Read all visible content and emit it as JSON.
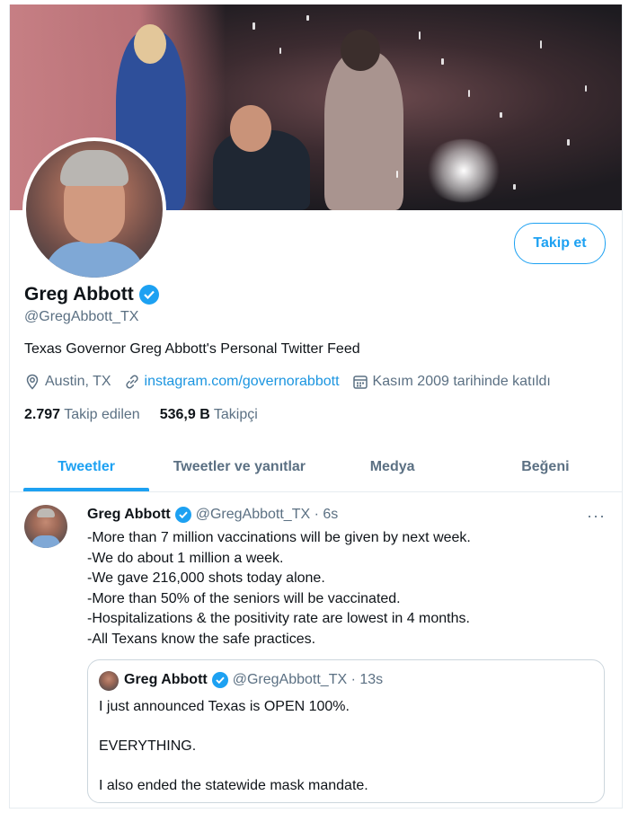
{
  "profile": {
    "name": "Greg Abbott",
    "handle": "@GregAbbott_TX",
    "bio": "Texas Governor Greg Abbott's Personal Twitter Feed",
    "location": "Austin, TX",
    "website": "instagram.com/governorabbott",
    "joined": "Kasım 2009 tarihinde katıldı",
    "following_count": "2.797",
    "following_label": "Takip edilen",
    "followers_count": "536,9 B",
    "followers_label": "Takipçi",
    "follow_button": "Takip et"
  },
  "tabs": [
    {
      "label": "Tweetler",
      "active": true
    },
    {
      "label": "Tweetler ve yanıtlar",
      "active": false
    },
    {
      "label": "Medya",
      "active": false
    },
    {
      "label": "Beğeni",
      "active": false
    }
  ],
  "tweet": {
    "name": "Greg Abbott",
    "handle_time": "@GregAbbott_TX · 6s",
    "lines": [
      "-More than 7 million vaccinations will be given by next week.",
      "-We do about 1 million a week.",
      "-We gave 216,000 shots today alone.",
      "-More than 50% of the seniors will be vaccinated.",
      "-Hospitalizations & the positivity rate are lowest in 4 months.",
      "-All Texans know the safe practices."
    ],
    "more": "···",
    "quote": {
      "name": "Greg Abbott",
      "handle_time": "@GregAbbott_TX · 13s",
      "lines": [
        "I just announced Texas is OPEN 100%.",
        "EVERYTHING.",
        "I also ended the statewide mask mandate."
      ]
    }
  },
  "colors": {
    "accent": "#1da1f2",
    "secondary_text": "#5b7083",
    "link": "#1b95e0"
  },
  "icons": [
    "location-pin-icon",
    "link-icon",
    "calendar-icon",
    "verified-badge-icon",
    "more-options-icon"
  ]
}
